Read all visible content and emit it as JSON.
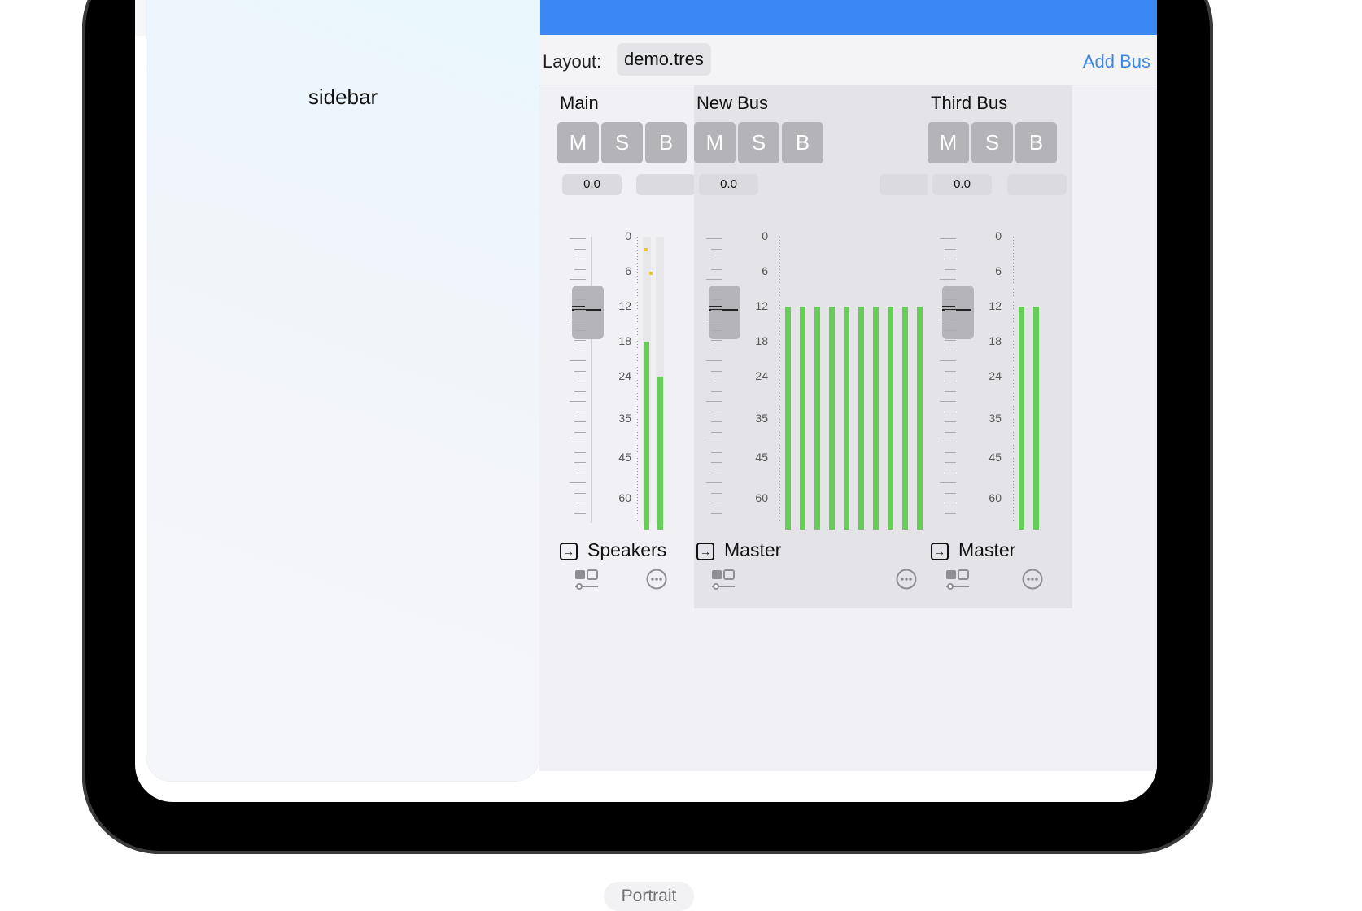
{
  "sidebar": {
    "label": "sidebar"
  },
  "toolbar": {
    "layout_label": "Layout:",
    "layout_value": "demo.tres",
    "add_bus_label": "Add Bus"
  },
  "buttons": {
    "mute": "M",
    "solo": "S",
    "bypass": "B"
  },
  "meter_scale": [
    "0",
    "6",
    "12",
    "18",
    "24",
    "35",
    "45",
    "60"
  ],
  "buses": [
    {
      "name": "Main",
      "volume_db": "0.0",
      "output": "Speakers",
      "channels": 2,
      "channel_levels_db": [
        18,
        24
      ],
      "channel_peaks_db": [
        2,
        6
      ]
    },
    {
      "name": "New Bus",
      "volume_db": "0.0",
      "output": "Master",
      "channels": 10,
      "channel_levels_db": [
        12,
        12,
        12,
        12,
        12,
        12,
        12,
        12,
        12,
        12
      ]
    },
    {
      "name": "Third Bus",
      "volume_db": "0.0",
      "output": "Master",
      "channels": 2,
      "channel_levels_db": [
        12,
        12
      ]
    }
  ],
  "footer": {
    "orientation_label": "Portrait"
  }
}
